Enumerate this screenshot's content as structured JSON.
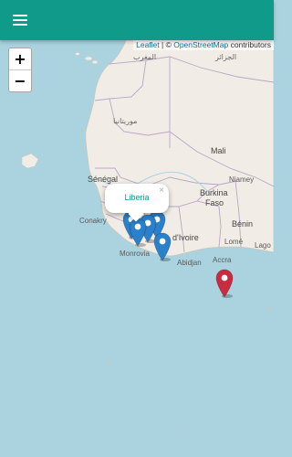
{
  "app_bar": {
    "menu_icon": "hamburger-menu-icon",
    "color": "#109a8a"
  },
  "zoom": {
    "in_label": "+",
    "out_label": "−"
  },
  "attribution": {
    "leaflet_link": "Leaflet",
    "separator": " | © ",
    "osm_link": "OpenStreetMap",
    "suffix": " contributors"
  },
  "popup": {
    "title": "Liberia",
    "close_label": "×"
  },
  "markers": [
    {
      "name": "marker-blue-1",
      "color": "#2a81cb"
    },
    {
      "name": "marker-blue-2",
      "color": "#2a81cb"
    },
    {
      "name": "marker-blue-3",
      "color": "#2a81cb"
    },
    {
      "name": "marker-blue-4",
      "color": "#2a81cb"
    },
    {
      "name": "marker-blue-5",
      "color": "#2a81cb"
    },
    {
      "name": "marker-red-1",
      "color": "#cb2b3e"
    }
  ],
  "map_labels": {
    "maghreb": "المغرب",
    "algeria": "الجزائر",
    "mauritania": "موريتانيا",
    "mali": "Mali",
    "senegal": "Sénégal",
    "niamey": "Niamey",
    "burkina": "Burkina",
    "faso": "Faso",
    "conakry": "Conakry",
    "monrovia": "Monrovia",
    "ivoire": "d'Ivoire",
    "abidjan": "Abidjan",
    "benin": "Bénin",
    "lome": "Lomé",
    "lagos": "Lago",
    "accra": "Accra"
  }
}
